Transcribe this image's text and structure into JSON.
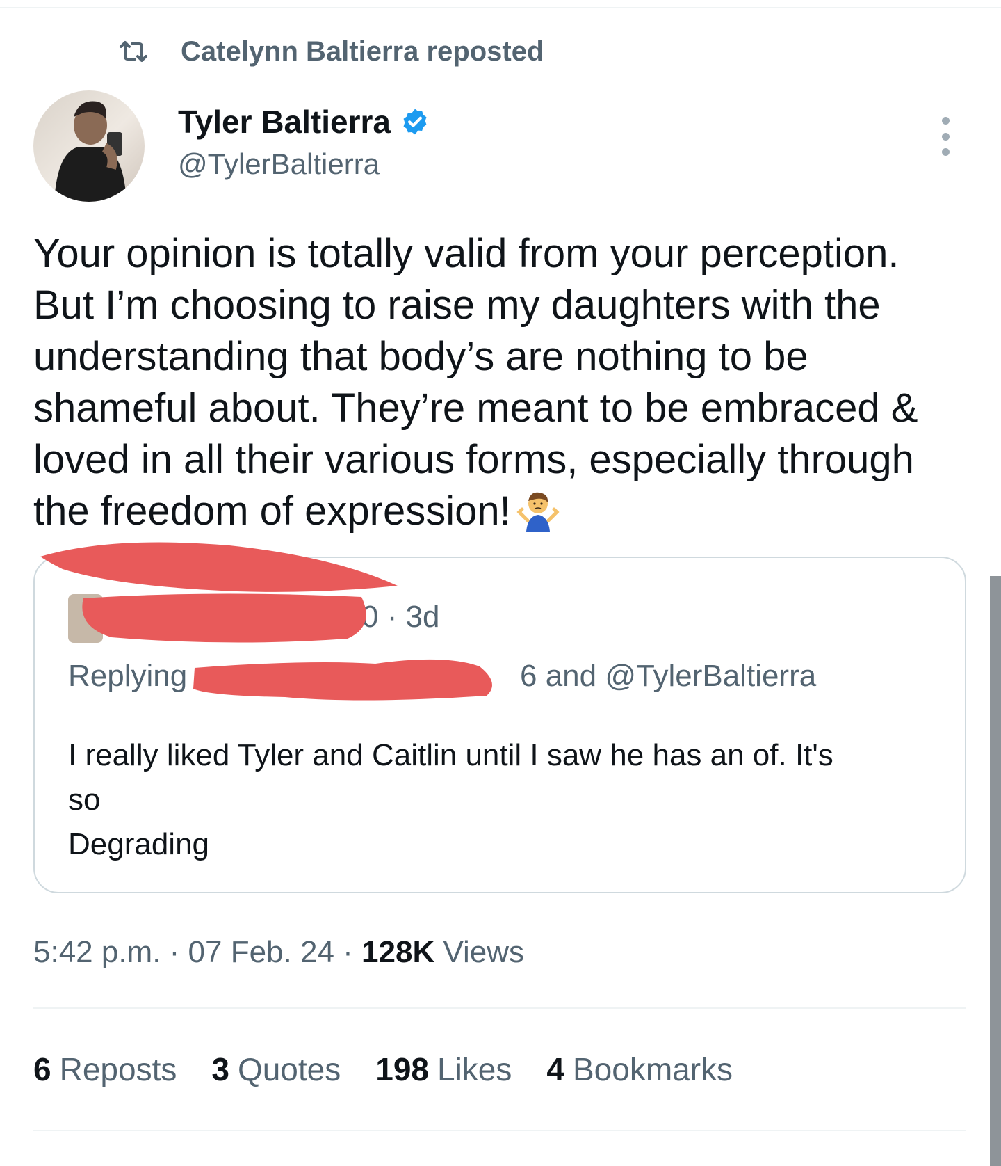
{
  "repost_banner": {
    "icon": "repost-icon",
    "text": "Catelynn Baltierra reposted"
  },
  "author": {
    "name": "Tyler Baltierra",
    "handle": "@TylerBaltierra",
    "verified": true,
    "verified_color": "#1d9bf0"
  },
  "tweet": {
    "text": "Your opinion is totally valid from your perception.\nBut I’m choosing to raise my daughters with the\nunderstanding that body’s are nothing to be\nshameful about. They’re meant to be embraced &\nloved in all their various forms, especially through\nthe freedom of expression!",
    "emoji": "🤷‍♂️"
  },
  "quoted": {
    "time": "0 · 3d",
    "replying_prefix": "Replying",
    "replying_suffix": "6 and @TylerBaltierra",
    "text": "I really liked Tyler and Caitlin until I saw he has an of. It's\nso\nDegrading",
    "redaction_color": "#e85a5a"
  },
  "meta": {
    "time": "5:42 p.m.",
    "date": "07 Feb. 24",
    "views_count": "128K",
    "views_label": "Views"
  },
  "stats": [
    {
      "count": "6",
      "label": "Reposts"
    },
    {
      "count": "3",
      "label": "Quotes"
    },
    {
      "count": "198",
      "label": "Likes"
    },
    {
      "count": "4",
      "label": "Bookmarks"
    }
  ],
  "colors": {
    "text": "#0f1419",
    "secondary": "#536471",
    "border": "#cfd9de",
    "accent": "#1d9bf0"
  }
}
